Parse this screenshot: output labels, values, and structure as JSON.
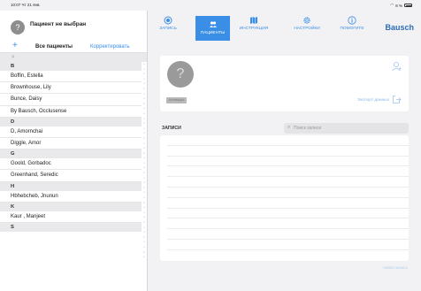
{
  "status": {
    "time": "10:07",
    "date": "Чт 21 янв.",
    "battery": "8 %"
  },
  "sidebar": {
    "patient_none": "Пациент не выбран",
    "all_patients": "Все пациенты",
    "edit": "Корректировать",
    "search_icon": "magnifier-icon",
    "rows": [
      {
        "type": "section",
        "text": "B"
      },
      {
        "type": "item",
        "text": "Boffin, Estella"
      },
      {
        "type": "item",
        "text": "Brownhouse, Lily"
      },
      {
        "type": "item",
        "text": "Bunce, Daisy"
      },
      {
        "type": "item",
        "text": "By Bausch, Occlusense"
      },
      {
        "type": "section",
        "text": "D"
      },
      {
        "type": "item",
        "text": "D, Amornchai"
      },
      {
        "type": "item",
        "text": "Diggle, Amor"
      },
      {
        "type": "section",
        "text": "G"
      },
      {
        "type": "item",
        "text": "Goold, Gorbadoc"
      },
      {
        "type": "item",
        "text": "Greenhand, Seredic"
      },
      {
        "type": "section",
        "text": "H"
      },
      {
        "type": "item",
        "text": "Hbhebcheb, Jnunun"
      },
      {
        "type": "section",
        "text": "K"
      },
      {
        "type": "item",
        "text": "Kaur , Manjeet"
      },
      {
        "type": "section",
        "text": "S"
      }
    ]
  },
  "nav": {
    "tabs": [
      {
        "label": "ЗАПИСЬ",
        "icon": "record-icon",
        "active": false
      },
      {
        "label": "ПАЦИЕНТЫ",
        "icon": "patients-icon",
        "active": true
      },
      {
        "label": "ИНСТРУКЦИЯ",
        "icon": "map-icon",
        "active": false
      },
      {
        "label": "НАСТРОЙКИ",
        "icon": "gear-icon",
        "active": false
      },
      {
        "label": "ПОМОГИТЕ",
        "icon": "info-icon",
        "active": false
      }
    ],
    "brand": "Bausch"
  },
  "card": {
    "activate": "Активация",
    "export": "Экспорт данных"
  },
  "records": {
    "title": "ЗАПИСИ",
    "search_placeholder": "Поиск записи",
    "new_record": "Новая запись"
  },
  "colors": {
    "accent": "#3a8ee6",
    "brand": "#2b6cb5"
  }
}
